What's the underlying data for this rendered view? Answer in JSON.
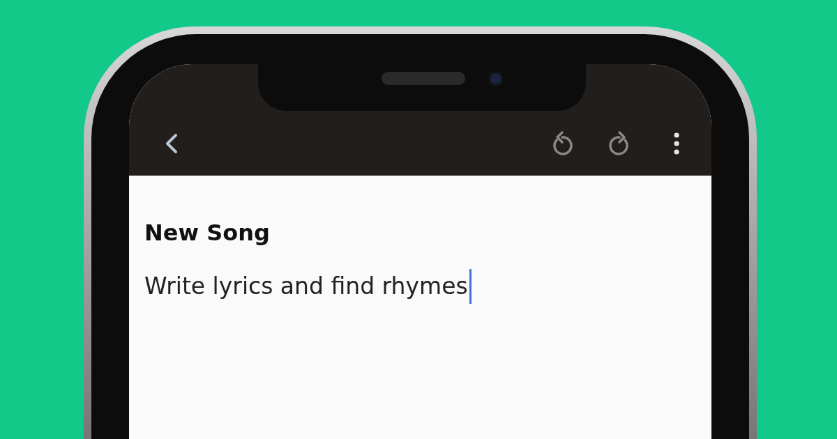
{
  "toolbar": {
    "buttons": [
      {
        "kind": "back",
        "disabled": false
      },
      {
        "kind": "undo",
        "disabled": true
      },
      {
        "kind": "redo",
        "disabled": true
      },
      {
        "kind": "more",
        "disabled": false
      }
    ]
  },
  "document": {
    "title": "New Song",
    "body": "Write lyrics and find rhymes",
    "cursor": true
  }
}
